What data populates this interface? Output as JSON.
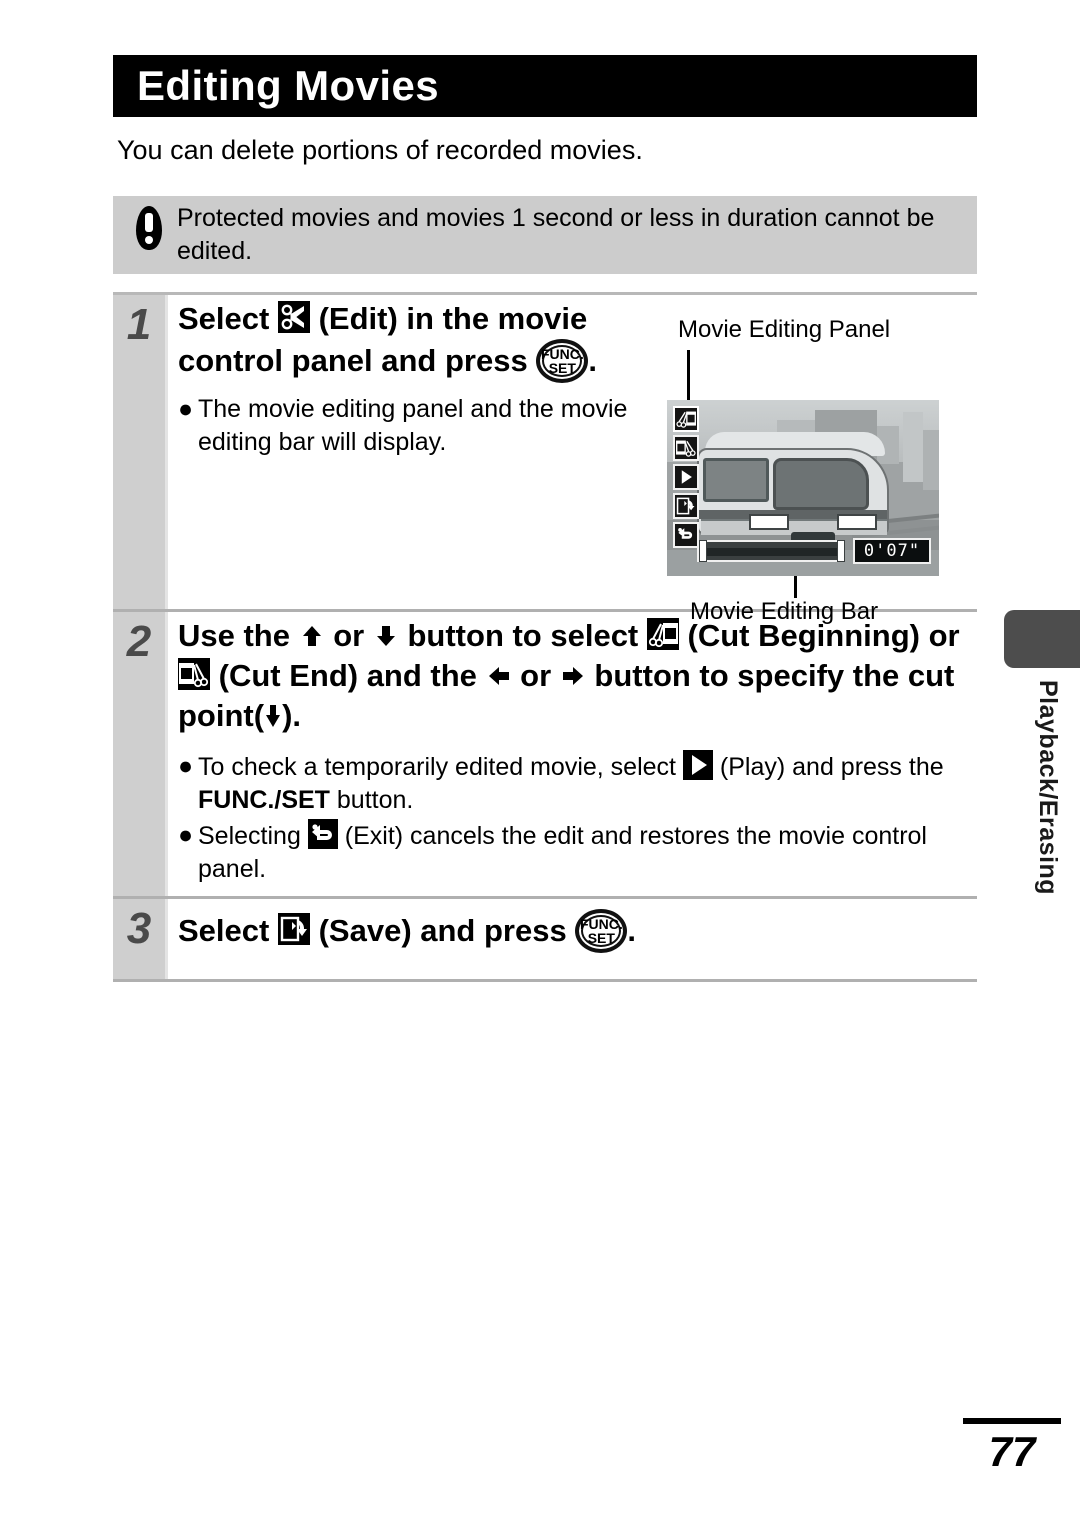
{
  "document": {
    "title": "Editing Movies",
    "intro": "You can delete portions of recorded movies.",
    "page_number": "77",
    "side_tab_label": "Playback/Erasing"
  },
  "warning": {
    "icon": "exclamation-icon",
    "text": "Protected movies and movies 1 second or less in duration cannot be edited."
  },
  "steps": [
    {
      "number": "1",
      "head_a": "Select",
      "head_icon": "edit-scissors-icon",
      "head_b": "(Edit) in the movie control panel and press",
      "head_button": "func-set-button",
      "head_c": ".",
      "bullets": [
        {
          "marker": "●",
          "text": "The movie editing panel and the movie editing bar will display."
        }
      ]
    },
    {
      "number": "2",
      "head_a": "Use the",
      "arrow_up": "⬆",
      "head_b": "or",
      "arrow_down": "⬇",
      "head_c": "button to select",
      "icon_cut_begin": "cut-beginning-icon",
      "head_d": "(Cut Beginning) or",
      "icon_cut_end": "cut-end-icon",
      "head_e": "(Cut End) and the",
      "arrow_left": "⬅",
      "head_f": "or",
      "arrow_right": "➡",
      "head_g": "button to specify the cut point(",
      "cut_point_marker": "⬇",
      "head_h": ").",
      "bullets": [
        {
          "marker": "●",
          "text_a": "To check a temporarily edited movie, select",
          "icon": "play-icon",
          "text_b": "(Play) and press the",
          "bold": "FUNC./SET",
          "text_c": "button."
        },
        {
          "marker": "●",
          "text_a": "Selecting",
          "icon": "exit-return-icon",
          "text_b": "(Exit) cancels the edit and restores the movie control panel."
        }
      ]
    },
    {
      "number": "3",
      "head_a": "Select",
      "head_icon": "save-icon",
      "head_b": "(Save) and press",
      "head_button": "func-set-button",
      "head_c": "."
    }
  ],
  "figure": {
    "label_panel": "Movie Editing Panel",
    "label_bar": "Movie Editing Bar",
    "timecode": "0'07\"",
    "panel_icons": [
      "cut-beginning-icon",
      "cut-end-icon",
      "play-icon",
      "save-icon",
      "exit-return-icon"
    ]
  },
  "func_set": {
    "line1": "FUNC.",
    "line2": "SET"
  },
  "colors": {
    "title_bar_bg": "#000000",
    "warning_bg": "#cccccc",
    "step_number_bg": "#cfcfcf",
    "side_tab_block": "#4d4d4d"
  }
}
